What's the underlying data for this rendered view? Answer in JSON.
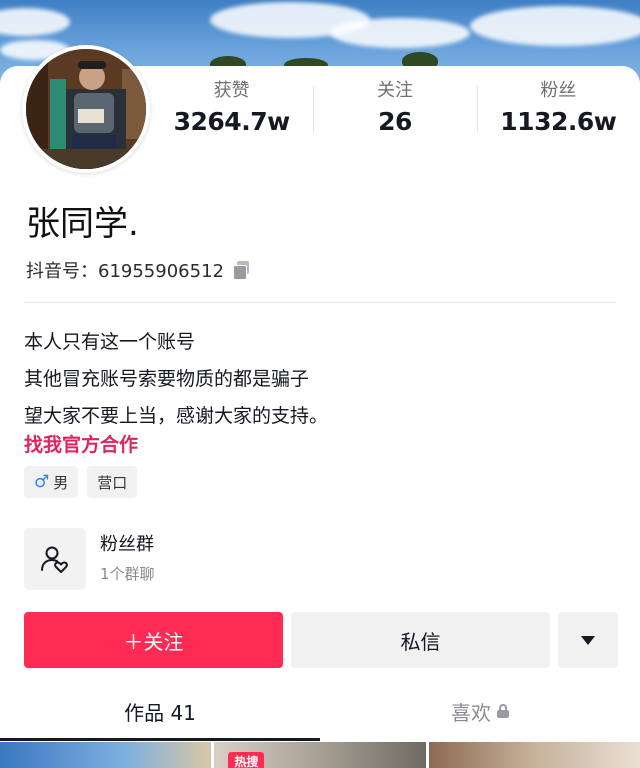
{
  "stats": [
    {
      "label": "获赞",
      "value": "3264.7w"
    },
    {
      "label": "关注",
      "value": "26"
    },
    {
      "label": "粉丝",
      "value": "1132.6w"
    }
  ],
  "profile": {
    "name": "张同学.",
    "douyin_id": "抖音号：61955906512"
  },
  "bio": {
    "lines": [
      "本人只有这一个账号",
      "其他冒充账号索要物质的都是骗子",
      "望大家不要上当，感谢大家的支持。"
    ],
    "link": "找我官方合作"
  },
  "tags": {
    "gender_icon": "♂",
    "gender": "男",
    "location": "营口"
  },
  "fan_group": {
    "title": "粉丝群",
    "subtitle": "1个群聊"
  },
  "actions": {
    "follow": "＋关注",
    "message": "私信"
  },
  "tabs": {
    "works": "作品 41",
    "likes": "喜欢"
  },
  "thumbnails": {
    "badge": "热搜"
  },
  "colors": {
    "accent": "#fe2c55",
    "link": "#e0245e"
  }
}
